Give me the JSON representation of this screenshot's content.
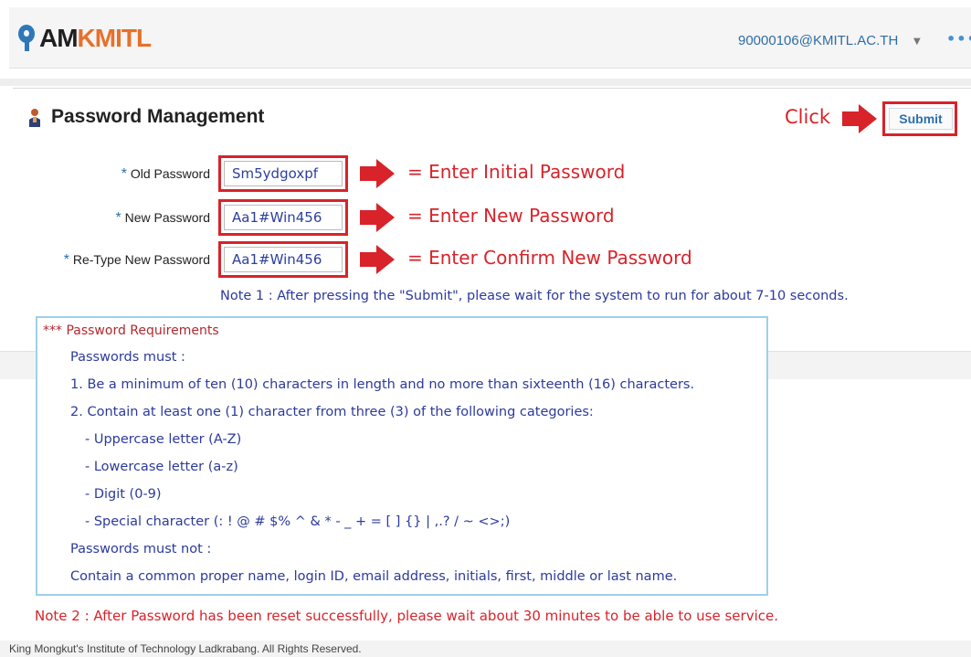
{
  "header": {
    "logo_part1": "AM",
    "logo_part2": "KMITL",
    "user": "90000106@KMITL.AC.TH",
    "more": "•••"
  },
  "page": {
    "title": "Password Management",
    "click_label": "Click",
    "submit_label": "Submit"
  },
  "form": {
    "old_label": "Old Password",
    "old_value": "Sm5ydgoxpf",
    "old_hint": "=  Enter Initial Password",
    "new_label": "New Password",
    "new_value": "Aa1#Win456",
    "new_hint": "=  Enter New Password",
    "retype_label": "Re-Type New Password",
    "retype_value": "Aa1#Win456",
    "retype_hint": "=  Enter Confirm New Password",
    "required_mark": "*"
  },
  "note1": "Note 1 : After pressing the \"Submit\", please wait for the system to run for about 7-10 seconds.",
  "requirements": {
    "title": "*** Password Requirements",
    "lines": [
      "Passwords must :",
      "1. Be a minimum of ten (10) characters in length and no more than sixteenth (16) characters.",
      "2. Contain at least one (1) character from three (3) of the following categories:",
      "- Uppercase letter (A-Z)",
      "- Lowercase letter (a-z)",
      "- Digit (0-9)",
      "- Special character (: ! @ # $% ^ & * - _ + = [ ] {} | ,.? / ~ <>;)",
      "Passwords must not :",
      "Contain a common proper name, login ID, email address, initials, first, middle or last name."
    ]
  },
  "note2": "Note 2 : After Password has been reset successfully, please wait about 30 minutes to be able to use service.",
  "footer": "King Mongkut's Institute of Technology Ladkrabang. All Rights Reserved.",
  "colors": {
    "annotation_red": "#d8232a",
    "text_blue": "#2c3a9c",
    "brand_orange": "#e8702a",
    "brand_blue": "#2e78b7"
  }
}
